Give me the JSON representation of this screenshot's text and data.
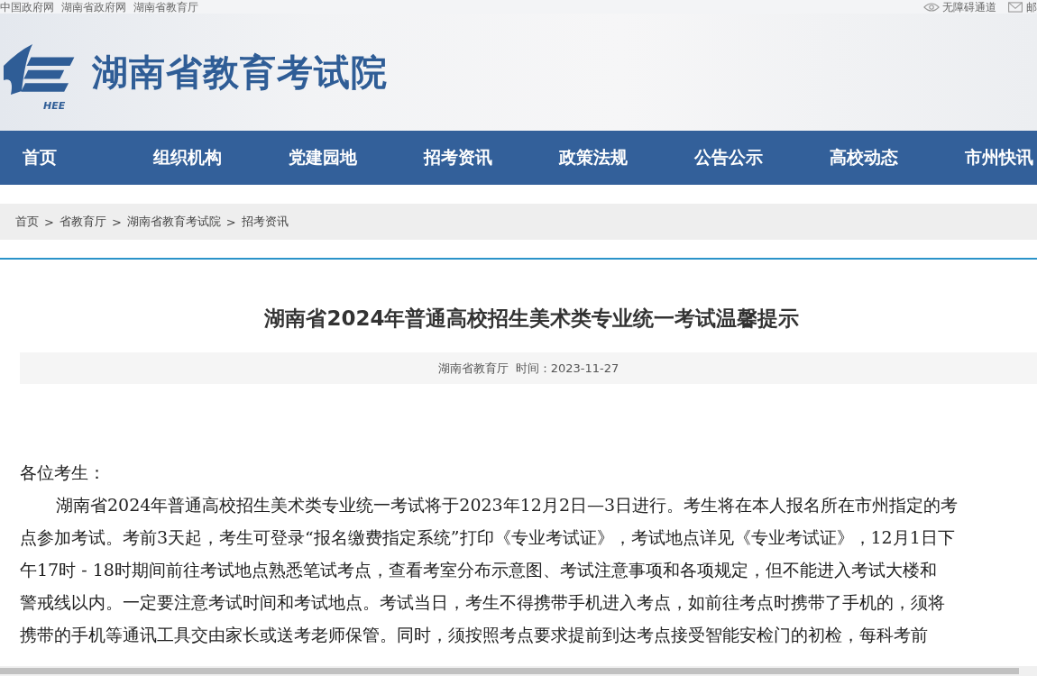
{
  "top_links": [
    "中国政府网",
    "湖南省政府网",
    "湖南省教育厅"
  ],
  "top_tools": [
    {
      "kind": "accessibility",
      "label": "无障碍通道"
    },
    {
      "kind": "mail",
      "label": "邮"
    }
  ],
  "header": {
    "logo_mark": "HEE",
    "site_name": "湖南省教育考试院"
  },
  "nav": [
    {
      "label": "首页"
    },
    {
      "label": "组织机构"
    },
    {
      "label": "党建园地"
    },
    {
      "label": "招考资讯"
    },
    {
      "label": "政策法规"
    },
    {
      "label": "公告公示"
    },
    {
      "label": "高校动态"
    },
    {
      "label": "市州快讯"
    }
  ],
  "breadcrumb": [
    "首页",
    "省教育厅",
    "湖南省教育考试院",
    "招考资讯"
  ],
  "breadcrumb_separator": ">",
  "article": {
    "title": "湖南省2024年普通高校招生美术类专业统一考试温馨提示",
    "source": "湖南省教育厅",
    "time": "时间：2023-11-27",
    "greeting": "各位考生：",
    "lines": [
      "湖南省2024年普通高校招生美术类专业统一考试将于2023年12月2日—3日进行。考生将在本人报名所在市州指定的考",
      "点参加考试。考前3天起，考生可登录“报名缴费指定系统”打印《专业考试证》，考试地点详见《专业考试证》，12月1日下",
      "午17时 - 18时期间前往考试地点熟悉笔试考点，查看考室分布示意图、考试注意事项和各项规定，但不能进入考试大楼和",
      "警戒线以内。一定要注意考试时间和考试地点。考试当日，考生不得携带手机进入考点，如前往考点时携带了手机的，须将",
      "携带的手机等通讯工具交由家长或送考老师保管。同时，须按照考点要求提前到达考点接受智能安检门的初检，每科考前"
    ]
  }
}
